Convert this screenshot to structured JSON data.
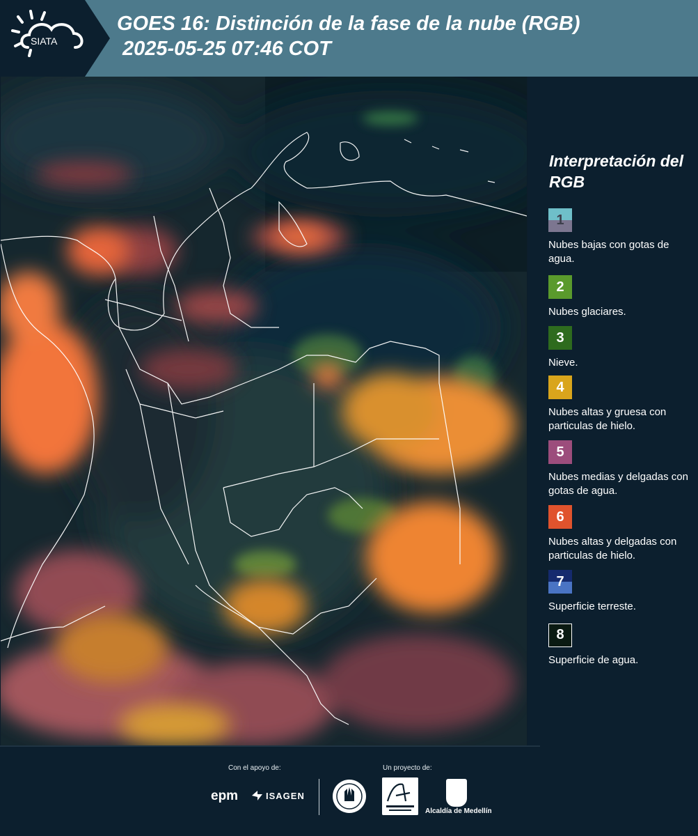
{
  "header": {
    "title_line1": "GOES 16: Distinción de la fase de la nube (RGB)",
    "title_line2": "2025-05-25 07:46 COT",
    "logo_text": "SIATA",
    "band_color": "#4d7a8c"
  },
  "legend": {
    "title": "Interpretación del RGB",
    "items": [
      {
        "number": "1",
        "label": "Nubes bajas con gotas de agua.",
        "color_top": "#6fbfc9",
        "color_bottom": "#7c7690"
      },
      {
        "number": "2",
        "label": "Nubes glaciares.",
        "color": "#5a9a2c"
      },
      {
        "number": "3",
        "label": "Nieve.",
        "color": "#2e6b1e"
      },
      {
        "number": "4",
        "label": "Nubes altas y gruesa con particulas de hielo.",
        "color": "#d9a51c"
      },
      {
        "number": "5",
        "label": "Nubes medias y delgadas con gotas de agua.",
        "color": "#9c4d7c"
      },
      {
        "number": "6",
        "label": "Nubes altas y delgadas con particulas de hielo.",
        "color": "#e0532d"
      },
      {
        "number": "7",
        "label": "Superficie terreste.",
        "color_top": "#152a6e",
        "color_bottom": "#4a74c4"
      },
      {
        "number": "8",
        "label": "Superficie de agua.",
        "color": "#0a1a12"
      }
    ]
  },
  "footer": {
    "support_label": "Con el apoyo de:",
    "project_label": "Un proyecto de:",
    "epm": "epm",
    "isagen": "ISAGEN",
    "alcaldia": "Alcaldía de Medellín"
  },
  "map": {
    "icon": "satellite-rgb-map"
  }
}
